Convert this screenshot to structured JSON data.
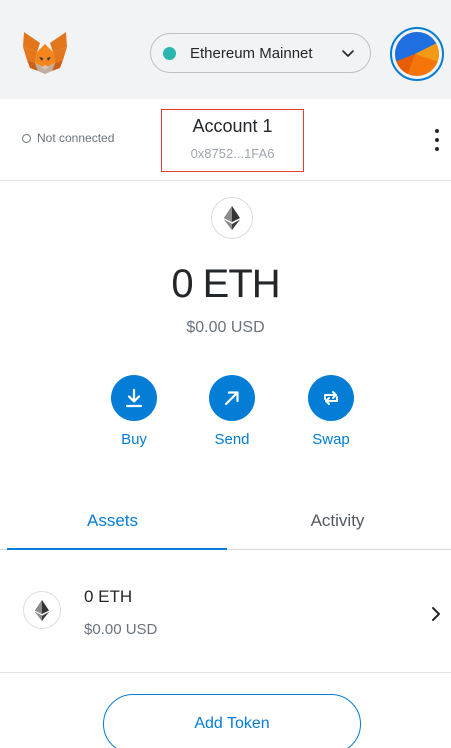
{
  "network": {
    "name": "Ethereum Mainnet",
    "dot_color": "#29b6af"
  },
  "connection": {
    "status": "Not connected"
  },
  "account": {
    "name": "Account 1",
    "address": "0x8752...1FA6"
  },
  "balance": {
    "primary": "0 ETH",
    "secondary": "$0.00 USD"
  },
  "actions": [
    {
      "label": "Buy",
      "icon": "download-icon"
    },
    {
      "label": "Send",
      "icon": "arrow-up-right-icon"
    },
    {
      "label": "Swap",
      "icon": "swap-arrows-icon"
    }
  ],
  "tabs": [
    {
      "label": "Assets",
      "active": true
    },
    {
      "label": "Activity",
      "active": false
    }
  ],
  "assets": [
    {
      "amount": "0 ETH",
      "usd": "$0.00 USD",
      "icon": "ethereum-icon"
    }
  ],
  "add_token": {
    "label": "Add Token"
  },
  "colors": {
    "primary": "#037dd6",
    "header_bg": "#f2f3f4",
    "highlight_border": "#e83a35"
  }
}
